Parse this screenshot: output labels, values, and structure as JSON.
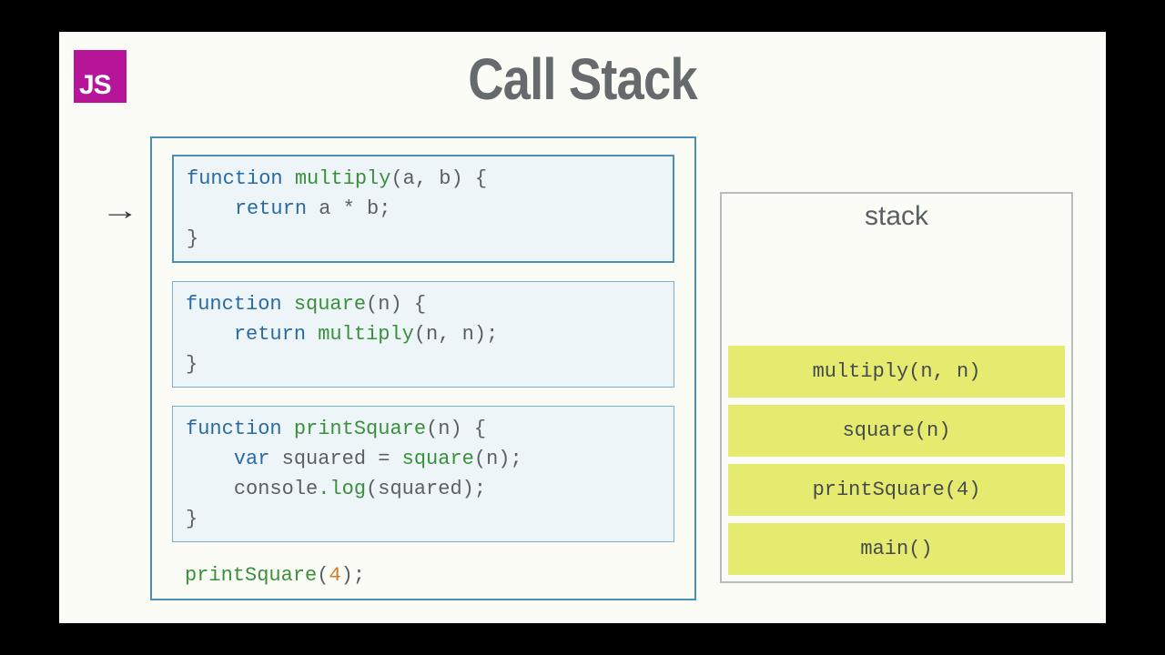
{
  "title": "Call Stack",
  "js_badge": "JS",
  "arrow_glyph": "→",
  "code": {
    "multiply": {
      "l1_kw": "function",
      "l1_fn": "multiply",
      "l1_args": "(a, b) {",
      "l2_kw": "return",
      "l2_expr": " a * b;",
      "l3": "}"
    },
    "square": {
      "l1_kw": "function",
      "l1_fn": "square",
      "l1_args": "(n) {",
      "l2_kw": "return",
      "l2_call_fn": "multiply",
      "l2_call_args": "(n, n);",
      "l3": "}"
    },
    "printSquare": {
      "l1_kw": "function",
      "l1_fn": "printSquare",
      "l1_args": "(n) {",
      "l2_kw": "var",
      "l2_id": " squared = ",
      "l2_call_fn": "square",
      "l2_call_args": "(n);",
      "l3_obj": "console",
      "l3_method": ".log",
      "l3_args": "(squared);",
      "l4": "}"
    },
    "call": {
      "fn": "printSquare",
      "open": "(",
      "arg": "4",
      "close": ");"
    }
  },
  "stack": {
    "label": "stack",
    "frames": [
      "multiply(n, n)",
      "square(n)",
      "printSquare(4)",
      "main()"
    ]
  }
}
